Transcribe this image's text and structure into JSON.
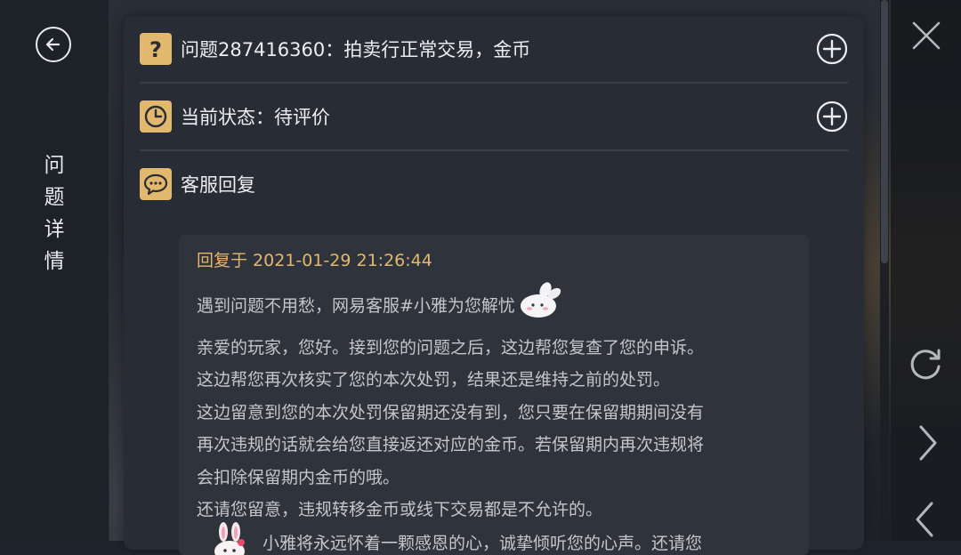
{
  "sidebar": {
    "title_chars": [
      "问",
      "题",
      "详",
      "情"
    ],
    "back_icon": "back-arrow-icon"
  },
  "rows": {
    "question": {
      "label": "问题287416360：拍卖行正常交易，金币",
      "icon": "question-icon"
    },
    "status": {
      "label": "当前状态：待评价",
      "icon": "clock-icon"
    },
    "reply_header": {
      "label": "客服回复",
      "icon": "chat-bubble-icon"
    }
  },
  "reply": {
    "time": "回复于 2021-01-29 21:26:44",
    "lines": [
      "遇到问题不用愁，网易客服#小雅为您解忧",
      "亲爱的玩家，您好。接到您的问题之后，这边帮您复查了您的申诉。",
      "这边帮您再次核实了您的本次处罚，结果还是维持之前的处罚。",
      "这边留意到您的本次处罚保留期还没有到，您只要在保留期期间没有",
      "再次违规的话就会给您直接返还对应的金币。若保留期内再次违规将",
      "会扣除保留期内金币的哦。",
      "还请您留意，违规转移金币或线下交易都是不允许的。"
    ],
    "footer": "小雅将永远怀着一颗感恩的心，诚挚倾听您的心声。还请您"
  },
  "colors": {
    "accent": "#e2b86e",
    "panel": "#282c34",
    "card": "#2f333b",
    "text": "#eceef1",
    "muted": "#c4c6ca"
  }
}
